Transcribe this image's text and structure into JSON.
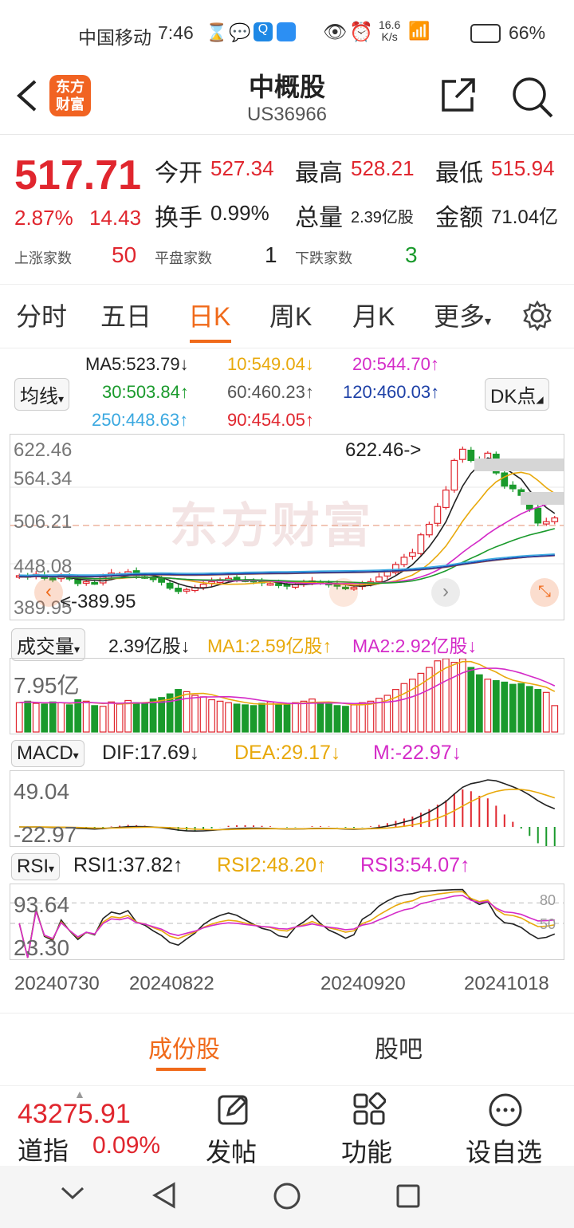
{
  "status_bar": {
    "carrier": "中国移动",
    "time": "7:46",
    "speed_top": "16.6",
    "speed_unit": "K/s",
    "battery": "66%"
  },
  "header": {
    "title": "中概股",
    "subtitle": "US36966",
    "logo_line1": "东方",
    "logo_line2": "财富"
  },
  "quote": {
    "price": "517.71",
    "change_pct": "2.87%",
    "change": "14.43",
    "open_label": "今开",
    "open": "527.34",
    "high_label": "最高",
    "high": "528.21",
    "low_label": "最低",
    "low": "515.94",
    "turnover_label": "换手",
    "turnover": "0.99%",
    "volume_label": "总量",
    "volume": "2.39亿股",
    "amount_label": "金额",
    "amount": "71.04亿",
    "up_label": "上涨家数",
    "up": "50",
    "flat_label": "平盘家数",
    "flat": "1",
    "down_label": "下跌家数",
    "down": "3"
  },
  "tabs": [
    "分时",
    "五日",
    "日K",
    "周K",
    "月K",
    "更多"
  ],
  "ma": {
    "dropdown": "均线",
    "dk": "DK点",
    "ma5": "MA5:523.79↓",
    "ma10": "10:549.04↓",
    "ma20": "20:544.70↑",
    "ma30": "30:503.84↑",
    "ma60": "60:460.23↑",
    "ma120": "120:460.03↑",
    "ma250": "250:448.63↑",
    "ma90": "90:454.05↑"
  },
  "kline": {
    "y_top": "622.46",
    "y_2": "564.34",
    "y_3": "506.21",
    "y_4": "448.08",
    "y_5": "389.95",
    "max_note": "622.46->",
    "min_note": "<-389.95",
    "watermark": "东方财富"
  },
  "volume": {
    "dropdown": "成交量",
    "value": "2.39亿股↓",
    "ma1": "MA1:2.59亿股↑",
    "ma2": "MA2:2.92亿股↓",
    "y_top": "7.95亿"
  },
  "macd": {
    "dropdown": "MACD",
    "dif": "DIF:17.69↓",
    "dea": "DEA:29.17↓",
    "m": "M:-22.97↓",
    "y_top": "49.04",
    "y_bottom": "-22.97"
  },
  "rsi": {
    "dropdown": "RSI",
    "rsi1": "RSI1:37.82↑",
    "rsi2": "RSI2:48.20↑",
    "rsi3": "RSI3:54.07↑",
    "y_top": "93.64",
    "y_bottom": "23.30",
    "mark80": "80",
    "mark50": "50"
  },
  "dates": [
    "20240730",
    "20240822",
    "20240920",
    "20241018"
  ],
  "bottom_tabs": [
    "成份股",
    "股吧"
  ],
  "dock": {
    "index_value": "43275.91",
    "index_name": "道指",
    "index_pct": "0.09%",
    "post": "发帖",
    "func": "功能",
    "fav": "设自选"
  },
  "chart_data": {
    "type": "candlestick",
    "closes": [
      430,
      428,
      432,
      426,
      424,
      430,
      425,
      418,
      421,
      419,
      428,
      434,
      433,
      436,
      430,
      428,
      424,
      420,
      411,
      406,
      409,
      412,
      417,
      421,
      424,
      426,
      425,
      423,
      421,
      419,
      418,
      415,
      414,
      417,
      419,
      422,
      419,
      416,
      414,
      411,
      412,
      418,
      421,
      428,
      436,
      447,
      458,
      465,
      492,
      508,
      535,
      560,
      605,
      622,
      605,
      596,
      616,
      586,
      566,
      562,
      552,
      531,
      510,
      512,
      517.71
    ],
    "volumes": [
      0.4,
      0.42,
      0.39,
      0.38,
      0.41,
      0.4,
      0.37,
      0.44,
      0.42,
      0.36,
      0.35,
      0.41,
      0.38,
      0.43,
      0.4,
      0.39,
      0.45,
      0.47,
      0.52,
      0.58,
      0.55,
      0.5,
      0.48,
      0.44,
      0.42,
      0.4,
      0.38,
      0.37,
      0.36,
      0.39,
      0.41,
      0.38,
      0.37,
      0.4,
      0.42,
      0.45,
      0.4,
      0.38,
      0.36,
      0.35,
      0.37,
      0.4,
      0.42,
      0.46,
      0.5,
      0.58,
      0.66,
      0.72,
      0.8,
      0.88,
      0.97,
      1.0,
      0.95,
      1.0,
      0.88,
      0.78,
      0.72,
      0.7,
      0.68,
      0.65,
      0.66,
      0.62,
      0.58,
      0.54,
      0.36
    ]
  }
}
